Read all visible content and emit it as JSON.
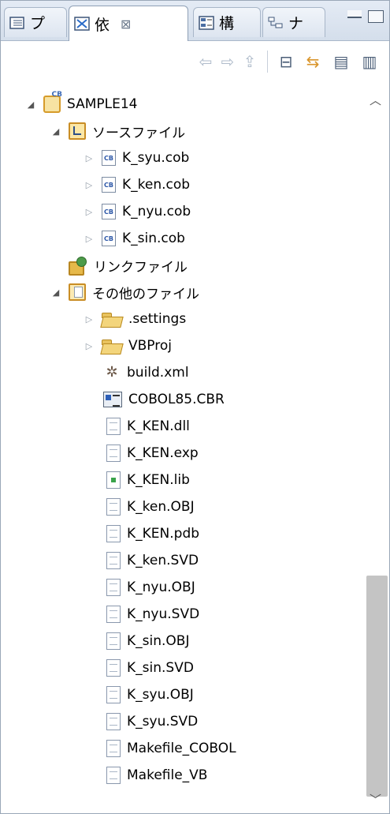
{
  "tabs": [
    {
      "label": "プ",
      "icon": "package-explorer-icon",
      "active": false
    },
    {
      "label": "依",
      "icon": "dependency-view-icon",
      "active": true,
      "close": "⊠"
    },
    {
      "label": "構",
      "icon": "structure-view-icon",
      "active": false
    },
    {
      "label": "ナ",
      "icon": "navigator-icon",
      "active": false
    }
  ],
  "window_buttons": [
    "minimize-icon",
    "maximize-icon"
  ],
  "toolbar": [
    {
      "icon": "back-arrow-icon",
      "glyph": "⇦",
      "enabled": false
    },
    {
      "icon": "forward-arrow-icon",
      "glyph": "⇨",
      "enabled": false
    },
    {
      "icon": "go-up-icon",
      "glyph": "⇪",
      "enabled": false
    },
    {
      "icon": "collapse-all-icon",
      "glyph": "⊟",
      "enabled": true
    },
    {
      "icon": "link-with-editor-icon",
      "glyph": "⇆",
      "enabled": true
    },
    {
      "icon": "view-menu-icon",
      "glyph": "▤",
      "enabled": true
    },
    {
      "icon": "filter-icon",
      "glyph": "▥",
      "enabled": true
    }
  ],
  "tree": [
    {
      "label": "SAMPLE14",
      "level": 0,
      "toggle": "expanded",
      "icon": "cobol-project-icon"
    },
    {
      "label": "ソースファイル",
      "level": 1,
      "toggle": "expanded",
      "icon": "source-folder-icon"
    },
    {
      "label": "K_syu.cob",
      "level": 2,
      "toggle": "collapsed",
      "icon": "cobol-file-icon"
    },
    {
      "label": "K_ken.cob",
      "level": 2,
      "toggle": "collapsed",
      "icon": "cobol-file-icon"
    },
    {
      "label": "K_nyu.cob",
      "level": 2,
      "toggle": "collapsed",
      "icon": "cobol-file-icon"
    },
    {
      "label": "K_sin.cob",
      "level": 2,
      "toggle": "collapsed",
      "icon": "cobol-file-icon"
    },
    {
      "label": "リンクファイル",
      "level": 1,
      "toggle": "none",
      "icon": "link-folder-icon"
    },
    {
      "label": "その他のファイル",
      "level": 1,
      "toggle": "expanded",
      "icon": "other-files-folder-icon"
    },
    {
      "label": ".settings",
      "level": 2,
      "toggle": "collapsed",
      "icon": "folder-icon"
    },
    {
      "label": "VBProj",
      "level": 2,
      "toggle": "collapsed",
      "icon": "folder-icon"
    },
    {
      "label": "build.xml",
      "level": 2,
      "toggle": "none",
      "icon": "ant-build-icon"
    },
    {
      "label": "COBOL85.CBR",
      "level": 2,
      "toggle": "none",
      "icon": "cbr-file-icon"
    },
    {
      "label": "K_KEN.dll",
      "level": 2,
      "toggle": "none",
      "icon": "file-icon"
    },
    {
      "label": "K_KEN.exp",
      "level": 2,
      "toggle": "none",
      "icon": "file-icon"
    },
    {
      "label": "K_KEN.lib",
      "level": 2,
      "toggle": "none",
      "icon": "library-file-icon"
    },
    {
      "label": "K_ken.OBJ",
      "level": 2,
      "toggle": "none",
      "icon": "file-icon"
    },
    {
      "label": "K_KEN.pdb",
      "level": 2,
      "toggle": "none",
      "icon": "file-icon"
    },
    {
      "label": "K_ken.SVD",
      "level": 2,
      "toggle": "none",
      "icon": "file-icon"
    },
    {
      "label": "K_nyu.OBJ",
      "level": 2,
      "toggle": "none",
      "icon": "file-icon"
    },
    {
      "label": "K_nyu.SVD",
      "level": 2,
      "toggle": "none",
      "icon": "file-icon"
    },
    {
      "label": "K_sin.OBJ",
      "level": 2,
      "toggle": "none",
      "icon": "file-icon"
    },
    {
      "label": "K_sin.SVD",
      "level": 2,
      "toggle": "none",
      "icon": "file-icon"
    },
    {
      "label": "K_syu.OBJ",
      "level": 2,
      "toggle": "none",
      "icon": "file-icon"
    },
    {
      "label": "K_syu.SVD",
      "level": 2,
      "toggle": "none",
      "icon": "file-icon"
    },
    {
      "label": "Makefile_COBOL",
      "level": 2,
      "toggle": "none",
      "icon": "file-icon"
    },
    {
      "label": "Makefile_VB",
      "level": 2,
      "toggle": "none",
      "icon": "file-icon"
    }
  ],
  "scrollbar": {
    "up_icon": "scroll-up-icon",
    "down_icon": "scroll-down-icon"
  }
}
